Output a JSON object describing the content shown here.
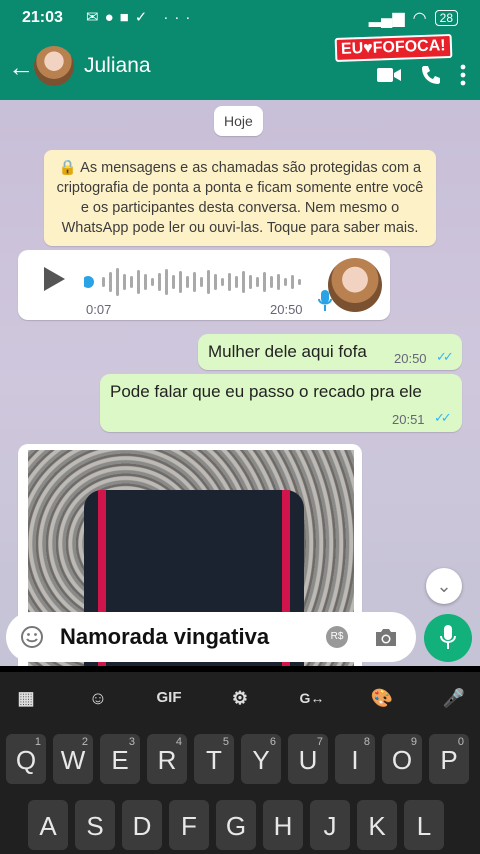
{
  "status": {
    "time": "21:03",
    "battery": "28"
  },
  "header": {
    "contact_name": "Juliana",
    "brand_text": "EU♥FOFOCA!"
  },
  "chat": {
    "date_chip": "Hoje",
    "notice": "As mensagens e as chamadas são protegidas com a criptografia de ponta a ponta e ficam somente entre você e os participantes desta conversa. Nem mesmo o WhatsApp pode ler ou ouvi-las. Toque para saber mais.",
    "voice_message": {
      "duration": "0:07",
      "time": "20:50"
    },
    "messages": [
      {
        "text": "Mulher dele aqui fofa",
        "time": "20:50",
        "status": "read"
      },
      {
        "text": "Pode falar que eu passo o recado pra ele",
        "time": "20:51",
        "status": "read"
      }
    ]
  },
  "composer": {
    "text": "Namorada vingativa",
    "payment_symbol": "R$"
  },
  "keyboard": {
    "toolbar": [
      "apps",
      "sticker",
      "GIF",
      "settings",
      "translate",
      "theme",
      "voice"
    ],
    "gif_label": "GIF",
    "row1": [
      {
        "k": "Q",
        "n": "1"
      },
      {
        "k": "W",
        "n": "2"
      },
      {
        "k": "E",
        "n": "3"
      },
      {
        "k": "R",
        "n": "4"
      },
      {
        "k": "T",
        "n": "5"
      },
      {
        "k": "Y",
        "n": "6"
      },
      {
        "k": "U",
        "n": "7"
      },
      {
        "k": "I",
        "n": "8"
      },
      {
        "k": "O",
        "n": "9"
      },
      {
        "k": "P",
        "n": "0"
      }
    ],
    "row2": [
      "A",
      "S",
      "D",
      "F",
      "G",
      "H",
      "J",
      "K",
      "L"
    ]
  },
  "colors": {
    "header": "#0a8a6e",
    "outgoing": "#dcf8c6",
    "accent": "#12b07a",
    "ticks": "#34b7f1"
  }
}
